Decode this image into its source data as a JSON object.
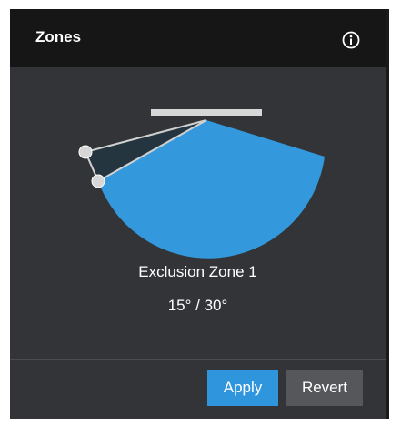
{
  "panel": {
    "title": "Zones"
  },
  "zone": {
    "name": "Exclusion Zone 1",
    "angles": "15° / 30°"
  },
  "actions": {
    "apply_label": "Apply",
    "revert_label": "Revert"
  },
  "colors": {
    "accent": "#2f96dd",
    "panel_bg": "#333438",
    "header_bg": "#161616",
    "revert_bg": "#55575b",
    "coverage_fill": "#3398dc",
    "exclusion_fill": "#25353f"
  },
  "icons": {
    "info": "info-icon"
  }
}
